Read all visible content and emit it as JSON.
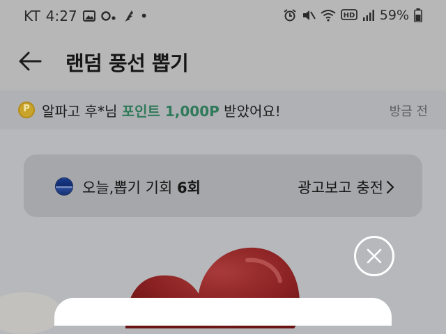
{
  "status_bar": {
    "carrier": "KT",
    "time": "4:27",
    "dot": "•",
    "battery": "59%",
    "icons_left": [
      "image-icon",
      "record-icon",
      "feather-icon"
    ],
    "icons_right": [
      "alarm-icon",
      "mute-icon",
      "wifi-icon",
      "hd-icon",
      "signal-icon",
      "battery-icon"
    ]
  },
  "header": {
    "title": "랜덤 풍선 뽑기",
    "back_icon": "arrow-left-icon"
  },
  "ticker": {
    "coin_letter": "P",
    "prefix": "알파고 후*님 ",
    "highlight": "포인트 1,000P",
    "suffix": " 받았어요!",
    "time_ago": "방금 전",
    "highlight_color": "#2f7a5a"
  },
  "draw_card": {
    "label": "오늘,뽑기 기회 ",
    "count": "6회",
    "link": "광고보고 충전",
    "link_chevron": "chevron-right-icon"
  },
  "overlay": {
    "close_icon": "close-icon"
  }
}
